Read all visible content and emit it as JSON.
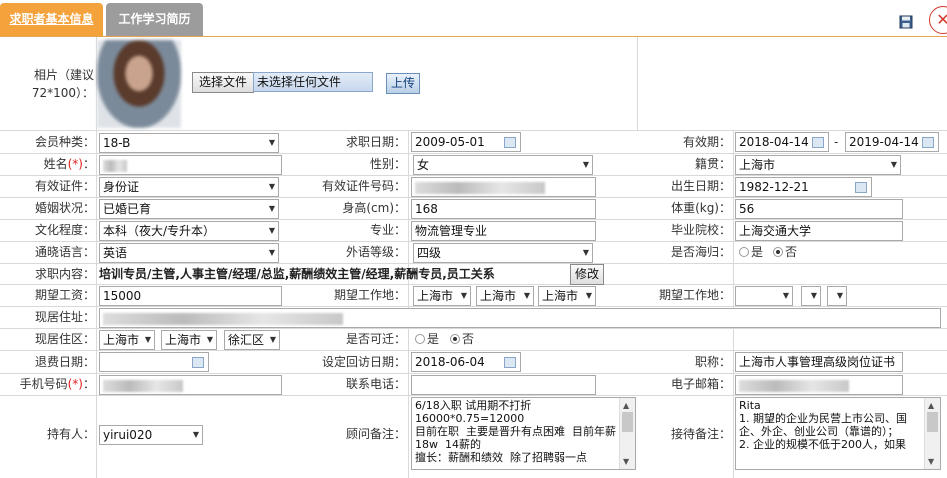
{
  "tabs": {
    "active": "求职者基本信息",
    "inactive": "工作学习简历"
  },
  "photo": {
    "label": "相片（建议72*100）：",
    "choose_file": "选择文件",
    "no_file": "未选择任何文件",
    "upload": "上传"
  },
  "row1": {
    "member_label": "会员种类：",
    "member_value": "18-B",
    "apply_date_label": "求职日期：",
    "apply_date_value": "2009-05-01",
    "valid_label": "有效期：",
    "valid_from": "2018-04-14",
    "valid_sep": "-",
    "valid_to": "2019-04-14"
  },
  "row2": {
    "name_label": "姓名",
    "req_mark": "(*)",
    "name_suffix": "：",
    "gender_label": "性别：",
    "gender_value": "女",
    "native_label": "籍贯：",
    "native_value": "上海市"
  },
  "row3": {
    "id_type_label": "有效证件：",
    "id_type_value": "身份证",
    "id_no_label": "有效证件号码：",
    "birth_label": "出生日期：",
    "birth_value": "1982-12-21"
  },
  "row4": {
    "marital_label": "婚姻状况：",
    "marital_value": "已婚已育",
    "height_label": "身高(cm)：",
    "height_value": "168",
    "weight_label": "体重(kg)：",
    "weight_value": "56"
  },
  "row5": {
    "edu_label": "文化程度：",
    "edu_value": "本科（夜大/专升本）",
    "major_label": "专业：",
    "major_value": "物流管理专业",
    "school_label": "毕业院校：",
    "school_value": "上海交通大学"
  },
  "row6": {
    "lang_label": "通晓语言：",
    "lang_value": "英语",
    "level_label": "外语等级：",
    "level_value": "四级",
    "abroad_label": "是否海归：",
    "yes": "是",
    "no": "否"
  },
  "row7": {
    "content_label": "求职内容：",
    "content_value": "培训专员/主管,人事主管/经理/总监,薪酬绩效主管/经理,薪酬专员,员工关系",
    "edit_button": "修改"
  },
  "row8": {
    "salary_label": "期望工资：",
    "salary_value": "15000",
    "place1_label": "期望工作地：",
    "place1_values": [
      "上海市",
      "上海市",
      "上海市"
    ],
    "place2_label": "期望工作地："
  },
  "row9": {
    "addr_label": "现居住址："
  },
  "row10": {
    "area_label": "现居住区：",
    "area_values": [
      "上海市",
      "上海市",
      "徐汇区"
    ],
    "move_label": "是否可迁：",
    "yes": "是",
    "no": "否"
  },
  "row11": {
    "refund_label": "退费日期：",
    "revisit_label": "设定回访日期：",
    "revisit_value": "2018-06-04",
    "title_label": "职称：",
    "title_value": "上海市人事管理高级岗位证书"
  },
  "row12": {
    "mobile_label": "手机号码",
    "req_mark": "(*)",
    "mobile_suffix": "：",
    "phone_label": "联系电话：",
    "email_label": "电子邮箱："
  },
  "row13": {
    "holder_label": "持有人：",
    "holder_value": "yirui020",
    "consult_label": "顾问备注：",
    "consult_text": "6/18入职 试用期不打折\n16000*0.75=12000\n目前在职  主要是晋升有点困难  目前年薪18w  14薪的\n擅长：薪酬和绩效  除了招聘弱一点",
    "reception_label": "接待备注：",
    "reception_text": "Rita\n1. 期望的企业为民营上市公司、国企、外企、创业公司（靠谱的）；\n2. 企业的规模不低于200人，如果"
  },
  "colors": {
    "tab_active": "#f3a23c",
    "tab_inactive": "#9c9c9c",
    "required": "#e02020"
  }
}
